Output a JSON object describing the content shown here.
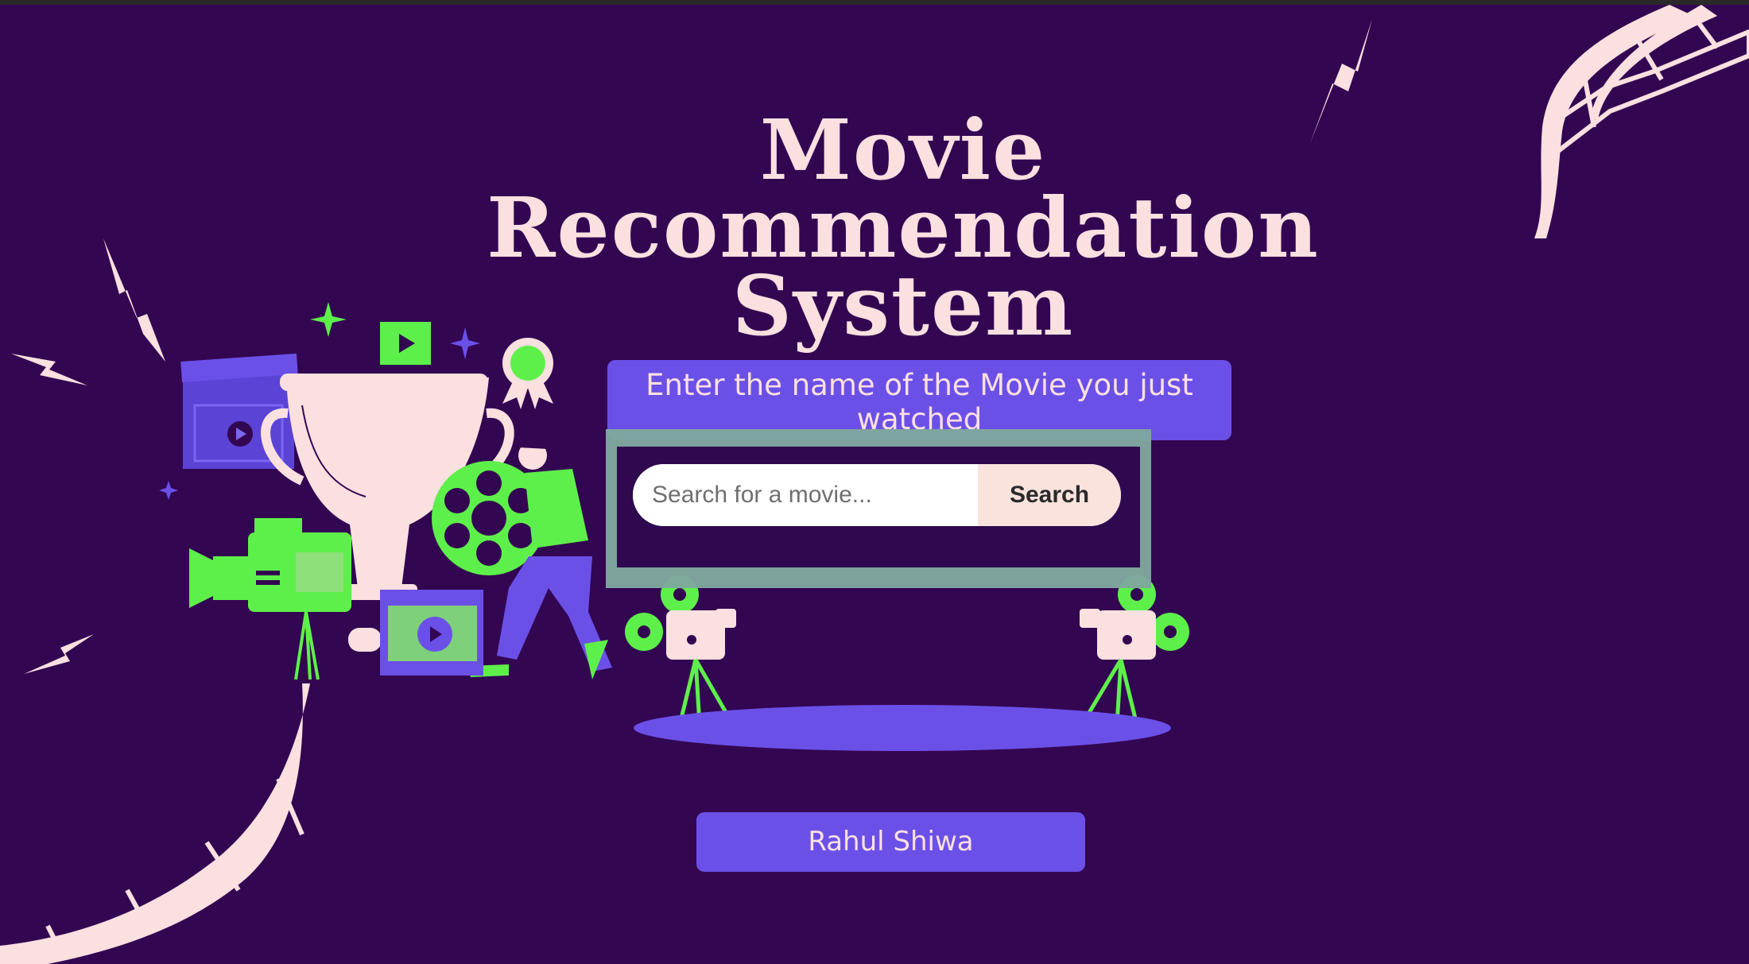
{
  "page": {
    "title_lines": [
      "Movie",
      "Recommendation",
      "System"
    ],
    "prompt": "Enter the name of the Movie you just watched",
    "search": {
      "placeholder": "Search for a movie...",
      "button_label": "Search"
    },
    "author": "Rahul Shiwa"
  },
  "colors": {
    "background": "#330652",
    "accent_purple": "#6b50e8",
    "accent_green": "#5ef04a",
    "cream": "#fbe0e0"
  },
  "icons": [
    "film-strip-icon",
    "lightning-icon",
    "trophy-icon",
    "clapperboard-icon",
    "video-camera-icon",
    "film-reel-icon",
    "movie-projector-icon",
    "play-icon",
    "award-badge-icon",
    "sparkle-icon"
  ]
}
